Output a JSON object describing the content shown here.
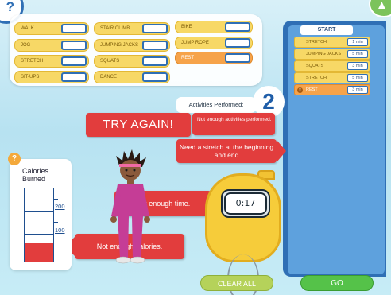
{
  "help_top": {
    "label": "?"
  },
  "palette": {
    "activities": [
      {
        "label": "WALK"
      },
      {
        "label": "STAIR CLIMB"
      },
      {
        "label": "BIKE"
      },
      {
        "label": "JOG"
      },
      {
        "label": "JUMPING JACKS"
      },
      {
        "label": "JUMP ROPE"
      },
      {
        "label": "STRETCH"
      },
      {
        "label": "SQUATS"
      },
      {
        "label": "REST"
      },
      {
        "label": "SIT-UPS"
      },
      {
        "label": "DANCE"
      }
    ]
  },
  "routine": {
    "start_label": "START",
    "items": [
      {
        "label": "STRETCH",
        "time": "1 min"
      },
      {
        "label": "JUMPING JACKS",
        "time": "5 min"
      },
      {
        "label": "SQUATS",
        "time": "3 min"
      },
      {
        "label": "STRETCH",
        "time": "5 min"
      },
      {
        "label": "REST",
        "time": "3 min"
      }
    ]
  },
  "activities_performed": {
    "label": "Activities Performed:",
    "count": "2"
  },
  "feedback": {
    "try_again": "TRY AGAIN!",
    "not_enough_activities": "Not enough activities performed.",
    "stretch_needed": "Need a stretch at the beginning and end",
    "not_enough_time": "Not enough time.",
    "not_enough_calories": "Not enough calories."
  },
  "calories": {
    "help": "?",
    "title": "Calories Burned",
    "ticks": [
      "200",
      "100"
    ],
    "fill_fraction": 0.25,
    "fill_color": "#e23d3d"
  },
  "stopwatch": {
    "time": "0:17"
  },
  "buttons": {
    "clear_all": "CLEAR ALL",
    "go": "GO"
  },
  "colors": {
    "panel_blue": "#2f6fb5",
    "alert_red": "#e23d3d",
    "go_green": "#55c249"
  }
}
